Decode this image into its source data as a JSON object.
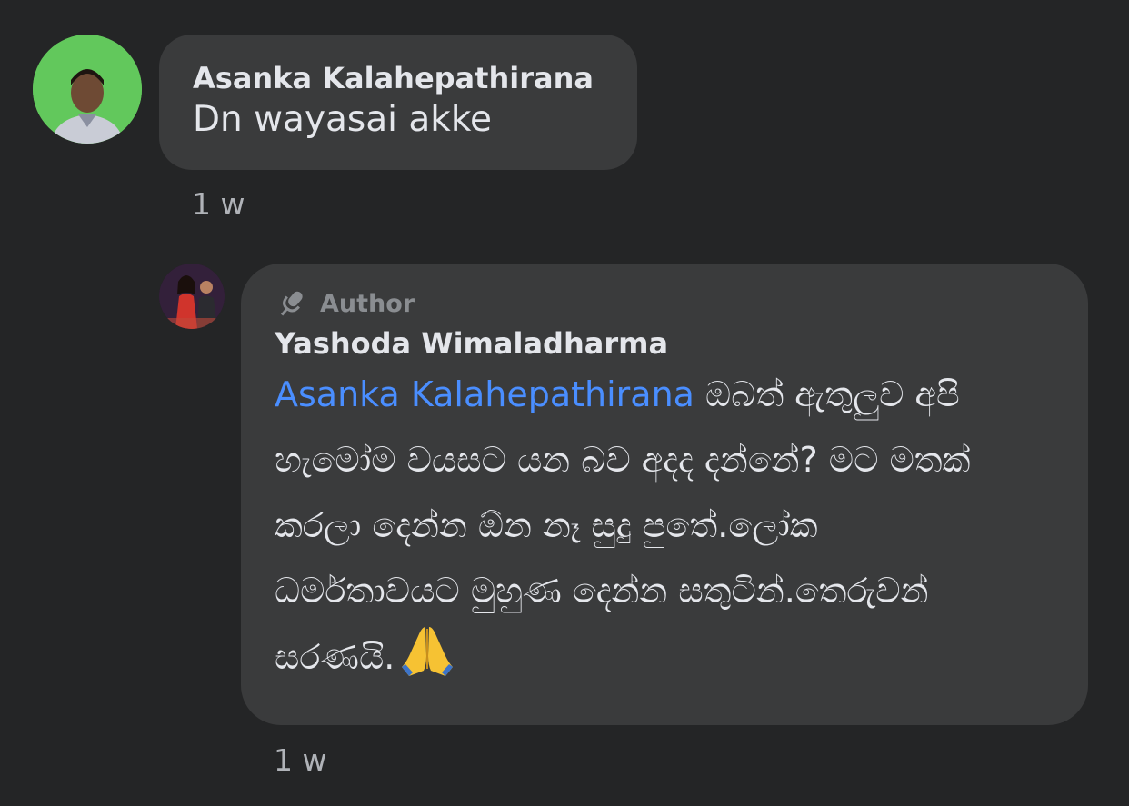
{
  "comments": [
    {
      "author": "Asanka Kalahepathirana",
      "text": "Dn wayasai akke",
      "time": "1 w",
      "avatar_icon": "user-avatar-photo"
    }
  ],
  "reply": {
    "badge": "Author",
    "badge_icon": "microphone-icon",
    "author": "Yashoda Wimaladharma",
    "mention": "Asanka Kalahepathirana",
    "lines": [
      "ඔබත් ඇතුලුව අපි",
      "හැමෝම වයසට යන බව අදද දන්නේ? මට මතක්",
      "කරලා දෙන්න ඕන නෑ සුදු පුතේ.ලෝක",
      "ධර්මතාවයට මුහුණ දෙන්න සතුටින්.තෙරුවන්",
      "සරණයි."
    ],
    "emoji_icon": "folded-hands-icon",
    "time": "1 w",
    "avatar_icon": "author-avatar-photo"
  },
  "colors": {
    "background": "#242526",
    "bubble": "#3a3b3c",
    "text": "#e4e6eb",
    "muted": "#b0b3b8",
    "mention": "#4a8eff"
  }
}
